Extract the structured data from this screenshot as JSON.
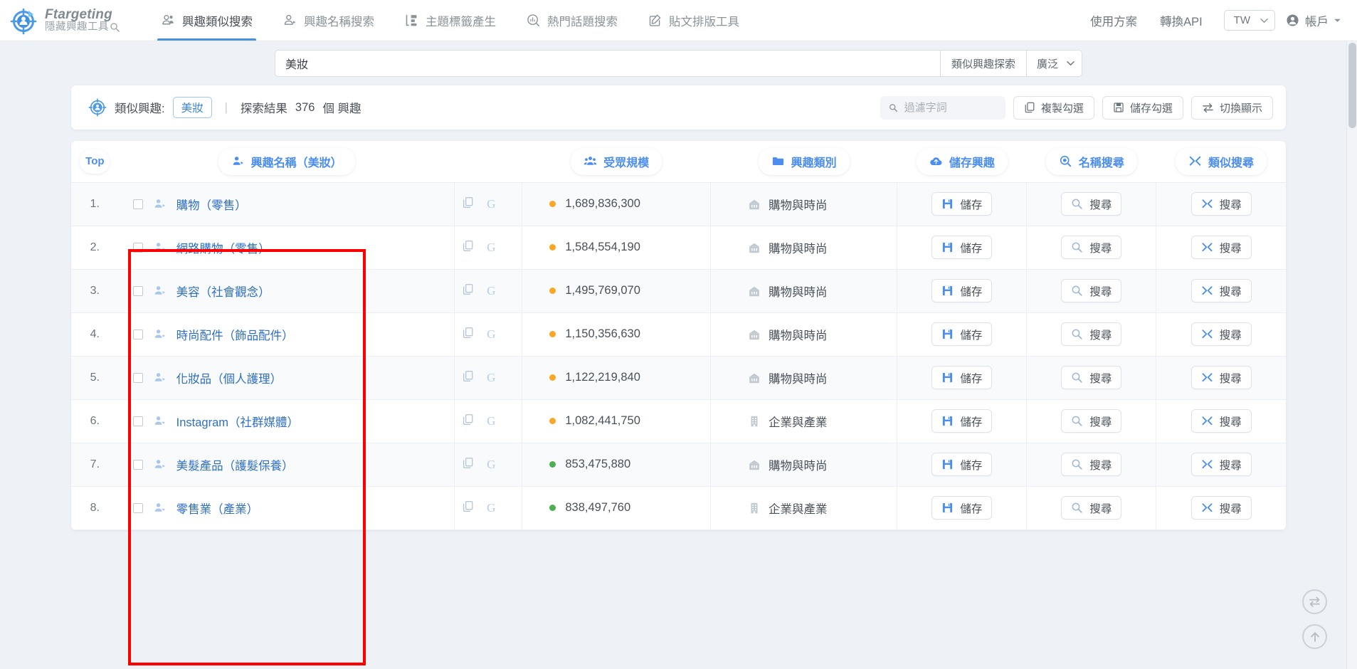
{
  "brand": {
    "name": "Ftargeting",
    "subtitle": "隱藏興趣工具",
    "logo_icon": "target-person-icon",
    "sub_icon": "magnifier-icon"
  },
  "nav": {
    "items": [
      {
        "label": "興趣類似搜索",
        "icon": "two-people-icon",
        "active": true
      },
      {
        "label": "興趣名稱搜索",
        "icon": "person-tag-icon",
        "active": false
      },
      {
        "label": "主題標籤產生",
        "icon": "bar-blocks-icon",
        "active": false
      },
      {
        "label": "熱門話題搜索",
        "icon": "trend-circle-icon",
        "active": false
      },
      {
        "label": "貼文排版工具",
        "icon": "pencil-square-icon",
        "active": false
      }
    ],
    "right_links": [
      {
        "label": "使用方案"
      },
      {
        "label": "轉換API"
      }
    ],
    "language": {
      "value": "TW",
      "caret_icon": "chevron-down-icon"
    },
    "account": {
      "label": "帳戶",
      "icon": "account-circle-icon",
      "caret_icon": "caret-down-icon"
    }
  },
  "search": {
    "query": "美妝",
    "placeholder": "",
    "mode_button": "類似興趣探索",
    "scope": {
      "value": "廣泛",
      "caret_icon": "chevron-down-icon"
    }
  },
  "summary": {
    "icon": "target-person-icon",
    "label": "類似興趣:",
    "keyword": "美妝",
    "divider": "|",
    "result_prefix": "探索結果",
    "result_count": "376",
    "result_suffix": "個 興趣",
    "filter_placeholder": "過濾字詞",
    "filter_value": "",
    "filter_icon": "search-icon",
    "actions": [
      {
        "label": "複製勾選",
        "icon": "copy-icon"
      },
      {
        "label": "儲存勾選",
        "icon": "save-disk-icon"
      },
      {
        "label": "切換顯示",
        "icon": "swap-arrows-icon"
      }
    ]
  },
  "table": {
    "headers": {
      "top": "Top",
      "name": "興趣名稱（美妝）",
      "name_icon": "person-tag-icon",
      "size": "受眾規模",
      "size_icon": "group-people-icon",
      "category": "興趣類別",
      "category_icon": "folder-icon",
      "save": "儲存興趣",
      "save_icon": "cloud-upload-icon",
      "name_search": "名稱搜尋",
      "name_search_icon": "search-circle-icon",
      "similar_search": "類似搜尋",
      "similar_search_icon": "shuffle-icon"
    },
    "row_actions": {
      "save": "儲存",
      "save_icon": "floppy-icon",
      "name_search": "搜尋",
      "name_search_icon": "magnifier-icon",
      "similar_search": "搜尋",
      "similar_search_icon": "shuffle-icon"
    },
    "cell_icons": {
      "person": "person-tag-icon",
      "copy": "copy-icon",
      "google": "G",
      "shopping": "shopping-bag-icon",
      "business": "building-icon"
    },
    "colors": {
      "dot_orange": "#f9a825",
      "dot_green": "#4caf50",
      "link": "#2f6fc4",
      "accent": "#4b8ef0",
      "annotation": "#fe0000"
    },
    "rows": [
      {
        "idx": "1.",
        "name": "購物（零售）",
        "size": "1,689,836,300",
        "dot": "orange",
        "category": "購物與時尚",
        "cat_icon": "shopping-bag-icon",
        "checked": false
      },
      {
        "idx": "2.",
        "name": "網路購物（零售）",
        "size": "1,584,554,190",
        "dot": "orange",
        "category": "購物與時尚",
        "cat_icon": "shopping-bag-icon",
        "checked": false
      },
      {
        "idx": "3.",
        "name": "美容（社會觀念）",
        "size": "1,495,769,070",
        "dot": "orange",
        "category": "購物與時尚",
        "cat_icon": "shopping-bag-icon",
        "checked": false
      },
      {
        "idx": "4.",
        "name": "時尚配件（飾品配件）",
        "size": "1,150,356,630",
        "dot": "orange",
        "category": "購物與時尚",
        "cat_icon": "shopping-bag-icon",
        "checked": false
      },
      {
        "idx": "5.",
        "name": "化妝品（個人護理）",
        "size": "1,122,219,840",
        "dot": "orange",
        "category": "購物與時尚",
        "cat_icon": "shopping-bag-icon",
        "checked": false
      },
      {
        "idx": "6.",
        "name": "Instagram（社群媒體）",
        "size": "1,082,441,750",
        "dot": "orange",
        "category": "企業與產業",
        "cat_icon": "building-icon",
        "checked": false
      },
      {
        "idx": "7.",
        "name": "美髮產品（護髮保養）",
        "size": "853,475,880",
        "dot": "green",
        "category": "購物與時尚",
        "cat_icon": "shopping-bag-icon",
        "checked": false
      },
      {
        "idx": "8.",
        "name": "零售業（產業）",
        "size": "838,497,760",
        "dot": "green",
        "category": "企業與產業",
        "cat_icon": "building-icon",
        "checked": false
      }
    ]
  },
  "fabs": [
    {
      "name": "toggle-display-fab",
      "icon": "swap-arrows-icon"
    },
    {
      "name": "scroll-top-fab",
      "icon": "arrow-up-icon"
    }
  ]
}
